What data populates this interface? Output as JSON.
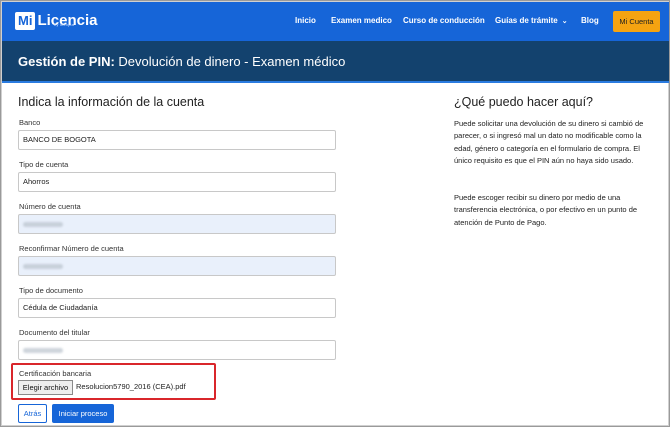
{
  "nav": {
    "logo_mi": "Mi",
    "logo_licencia": "Licencia",
    "logo_sub": "by olimpia",
    "links": [
      "Inicio",
      "Examen medico",
      "Curso de conducción",
      "Guías de trámite",
      "Blog"
    ],
    "cta": "Mi Cuenta",
    "colors": {
      "nav_bg": "#1665d8",
      "cta_bg": "#f5a311",
      "title_bg": "#13426e"
    }
  },
  "title": {
    "prefix": "Gestión de PIN:",
    "rest": " Devolución de dinero - Examen médico"
  },
  "form": {
    "heading": "Indica la información de la cuenta",
    "banco_label": "Banco",
    "banco_value": "BANCO DE BOGOTA",
    "tipo_cuenta_label": "Tipo de cuenta",
    "tipo_cuenta_value": "Ahorros",
    "numero_cuenta_label": "Número de cuenta",
    "reconfirmar_label": "Reconfirmar Número de cuenta",
    "tipo_documento_label": "Tipo de documento",
    "tipo_documento_value": "Cédula de Ciudadanía",
    "documento_titular_label": "Documento del titular",
    "certificacion_label": "Certificación bancaria",
    "file_button": "Elegir archivo",
    "file_name": "Resolucion5790_2016 (CEA).pdf",
    "back_button": "Atrás",
    "start_button": "Iniciar proceso"
  },
  "help": {
    "heading": "¿Qué puedo hacer aquí?",
    "p1": "Puede solicitar una devolución de su dinero si cambió de parecer, o si ingresó mal un dato no modificable como la edad, género o categoría en el formulario de compra. El único requisito es que el PIN aún no haya sido usado.",
    "p2": "Puede escoger recibir su dinero por medio de una transferencia electrónica, o por efectivo en un punto de atención de Punto de Pago."
  }
}
